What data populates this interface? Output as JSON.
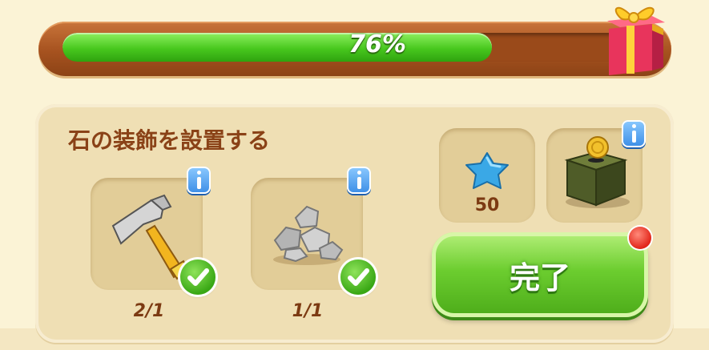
{
  "progress": {
    "value_percent": 76,
    "label": "76%"
  },
  "task": {
    "title": "石の装飾を設置する"
  },
  "requirements": [
    {
      "icon": "hammer-icon",
      "count": "2/1",
      "completed": true
    },
    {
      "icon": "stones-icon",
      "count": "1/1",
      "completed": true
    }
  ],
  "rewards": [
    {
      "icon": "blue-star-icon",
      "value": "50"
    },
    {
      "icon": "coin-box-icon"
    }
  ],
  "complete_button": {
    "label": "完了"
  },
  "colors": {
    "progress_green": "#48c81e",
    "button_green": "#6ccd2f",
    "title_brown": "#8a4217",
    "notification_red": "#e2261a"
  }
}
